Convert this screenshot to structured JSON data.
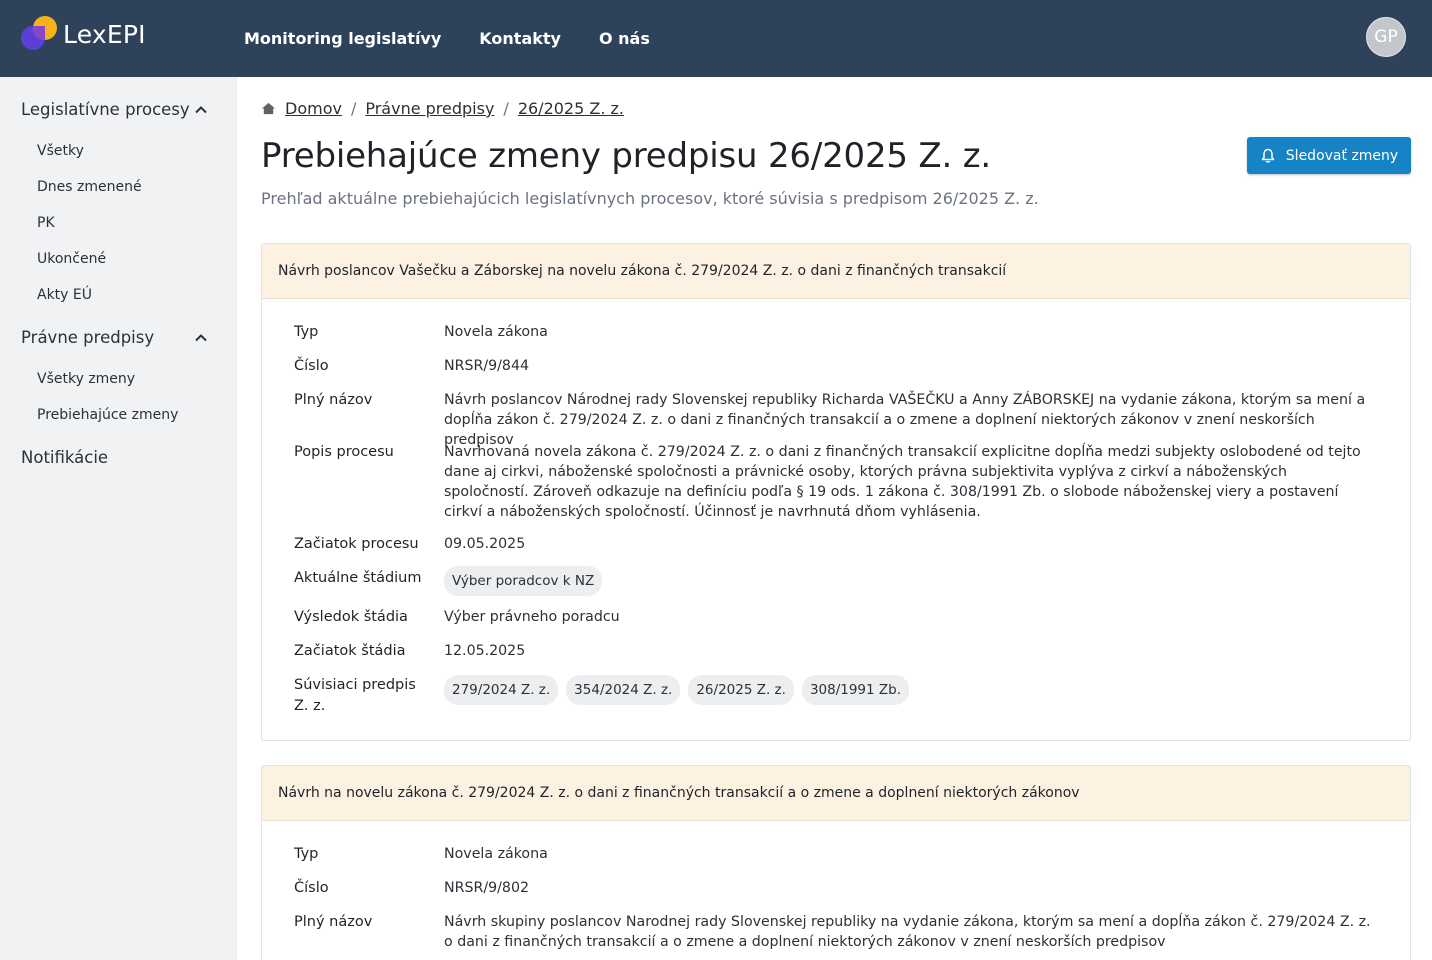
{
  "app": {
    "name": "LexEPI"
  },
  "topnav": [
    "Monitoring legislatívy",
    "Kontakty",
    "O nás"
  ],
  "user": {
    "initials": "GP"
  },
  "sidebar": {
    "groups": [
      {
        "label": "Legislatívne procesy",
        "items": [
          "Všetky",
          "Dnes zmenené",
          "PK",
          "Ukončené",
          "Akty EÚ"
        ]
      },
      {
        "label": "Právne predpisy",
        "items": [
          "Všetky zmeny",
          "Prebiehajúce zmeny"
        ]
      },
      {
        "label": "Notifikácie",
        "items": []
      }
    ]
  },
  "breadcrumb": [
    "Domov",
    "Právne predpisy",
    "26/2025 Z. z."
  ],
  "page": {
    "title": "Prebiehajúce zmeny predpisu 26/2025 Z. z.",
    "subtitle": "Prehľad aktuálne prebiehajúcich legislatívnych procesov, ktoré súvisia s predpisom 26/2025 Z. z.",
    "follow_button": "Sledovať zmeny"
  },
  "labels": {
    "typ": "Typ",
    "cislo": "Číslo",
    "plny_nazov": "Plný názov",
    "popis": "Popis procesu",
    "zaciatok_procesu": "Začiatok procesu",
    "aktualne_stadium": "Aktuálne štádium",
    "vysledok_stadia": "Výsledok štádia",
    "zaciatok_stadia": "Začiatok štádia",
    "suvisiaci": "Súvisiaci predpis Z. z."
  },
  "cards": [
    {
      "title": "Návrh poslancov Vašečku a Záborskej na novelu zákona č. 279/2024 Z. z. o dani z finančných transakcií",
      "typ": "Novela zákona",
      "cislo": "NRSR/9/844",
      "plny_nazov": "Návrh poslancov Národnej rady Slovenskej republiky Richarda VAŠEČKU a Anny ZÁBORSKEJ na vydanie zákona, ktorým sa mení a dopĺňa zákon č. 279/2024 Z. z. o dani z finančných transakcií a o zmene a doplnení niektorých zákonov v znení neskorších predpisov",
      "popis": "Navrhovaná novela zákona č. 279/2024 Z. z. o dani z finančných transakcií explicitne dopĺňa medzi subjekty oslobodené od tejto dane aj cirkvi, náboženské spoločnosti a právnické osoby, ktorých právna subjektivita vyplýva z cirkví a náboženských spoločností. Zároveň odkazuje na definíciu podľa § 19 ods. 1 zákona č. 308/1991 Zb. o slobode náboženskej viery a postavení cirkví a náboženských spoločností. Účinnosť je navrhnutá dňom vyhlásenia.",
      "zaciatok_procesu": "09.05.2025",
      "aktualne_stadium": "Výber poradcov k NZ",
      "vysledok_stadia": "Výber právneho poradcu",
      "zaciatok_stadia": "12.05.2025",
      "suvisiace": [
        "279/2024 Z. z.",
        "354/2024 Z. z.",
        "26/2025 Z. z.",
        "308/1991 Zb."
      ]
    },
    {
      "title": "Návrh na novelu zákona č. 279/2024 Z. z. o dani z finančných transakcií a o zmene a doplnení niektorých zákonov",
      "typ": "Novela zákona",
      "cislo": "NRSR/9/802",
      "plny_nazov": "Návrh skupiny poslancov Narodnej rady Slovenskej republiky na vydanie zákona, ktorým sa mení a dopĺňa zákon č. 279/2024 Z. z. o dani z finančných transakcií a o zmene a doplnení niektorých zákonov v znení neskorších predpisov"
    }
  ],
  "colors": {
    "topbar": "#2e4259",
    "accent": "#1583c6",
    "card_header": "#fdf1e2",
    "sidebar": "#f1f2f4"
  }
}
